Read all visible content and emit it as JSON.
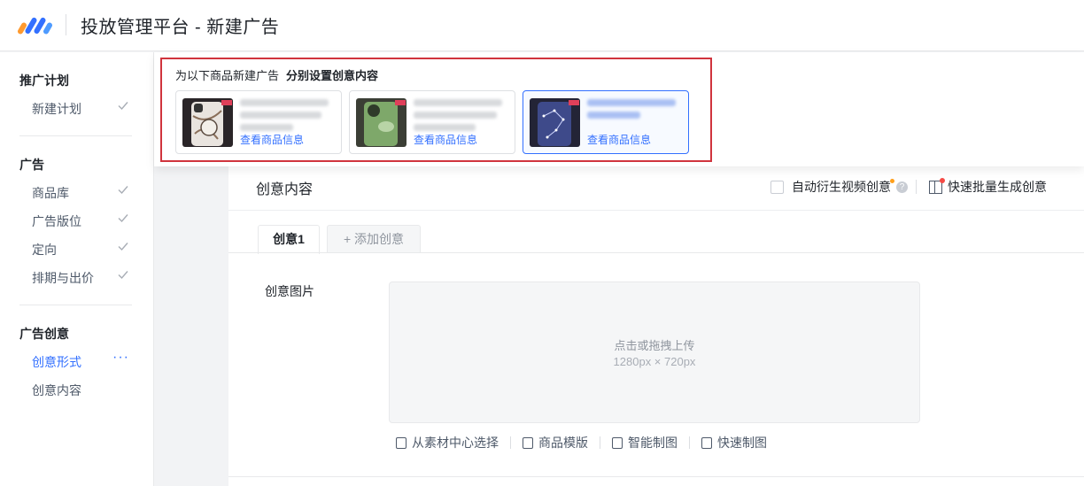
{
  "header": {
    "title": "投放管理平台 - 新建广告",
    "logo_colors": [
      "#ff9a2e",
      "#3370ff",
      "#4e9bff"
    ]
  },
  "sidebar": {
    "groups": [
      {
        "label": "推广计划",
        "items": [
          {
            "label": "新建计划",
            "status": "done"
          }
        ]
      },
      {
        "label": "广告",
        "items": [
          {
            "label": "商品库",
            "status": "done"
          },
          {
            "label": "广告版位",
            "status": "done"
          },
          {
            "label": "定向",
            "status": "done"
          },
          {
            "label": "排期与出价",
            "status": "done"
          }
        ]
      },
      {
        "label": "广告创意",
        "items": [
          {
            "label": "创意形式",
            "status": "in-progress"
          },
          {
            "label": "创意内容",
            "status": "pending"
          }
        ]
      }
    ],
    "more_glyph": "···"
  },
  "popover": {
    "title": "为以下商品新建广告",
    "subtitle": "分别设置创意内容",
    "products": [
      {
        "link": "查看商品信息",
        "selected": false
      },
      {
        "link": "查看商品信息",
        "selected": false
      },
      {
        "link": "查看商品信息",
        "selected": true
      }
    ]
  },
  "card": {
    "title": "创意内容",
    "auto_video_label": "自动衍生视频创意",
    "help_glyph": "?",
    "batch_label": "快速批量生成创意",
    "tabs": [
      {
        "label": "创意1",
        "active": true
      },
      {
        "label": "+ 添加创意",
        "active": false
      }
    ],
    "field_label": "创意图片",
    "upload": {
      "main": "点击或拖拽上传",
      "sub": "1280px × 720px"
    },
    "tools": [
      {
        "label": "从素材中心选择",
        "icon": "image-library-icon"
      },
      {
        "label": "商品模版",
        "icon": "template-icon"
      },
      {
        "label": "智能制图",
        "icon": "ai-image-icon"
      },
      {
        "label": "快速制图",
        "icon": "quick-image-icon"
      }
    ]
  },
  "colors": {
    "accent": "#3370ff",
    "highlight_border": "#d0343d",
    "new_dot": "#ff9f1a",
    "badge_dot": "#f54a45"
  }
}
